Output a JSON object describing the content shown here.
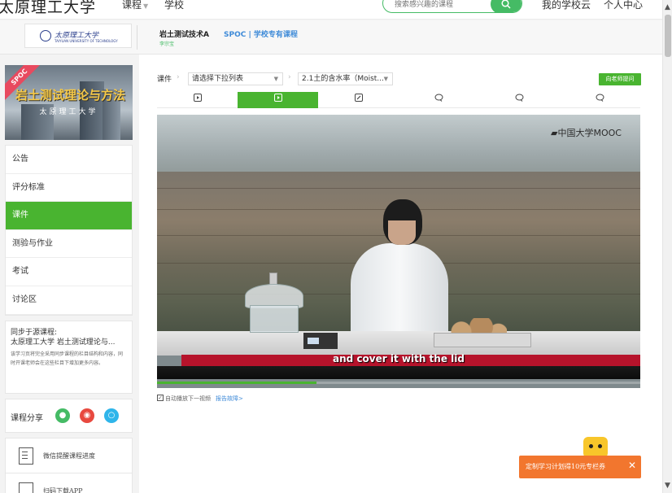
{
  "topnav": {
    "brand": "太原理工大学",
    "course_menu": "课程",
    "school_menu": "学校",
    "search_placeholder": "搜索感兴趣的课程",
    "my_school_cloud": "我的学校云",
    "user_center": "个人中心"
  },
  "course_header": {
    "title": "岩土测试技术A",
    "spoc_label": "SPOC | 学校专有课程",
    "teacher": "李宗宝"
  },
  "sidebar": {
    "cover": {
      "ribbon": "SPOC",
      "title": "岩土测试理论与方法",
      "school": "太原理工大学"
    },
    "menu": [
      {
        "label": "公告"
      },
      {
        "label": "评分标准"
      },
      {
        "label": "课件",
        "active": true
      },
      {
        "label": "测验与作业"
      },
      {
        "label": "考试"
      },
      {
        "label": "讨论区"
      }
    ],
    "sync": {
      "line1": "同步于源课程:",
      "line2": "太原理工大学 岩土测试理论与...",
      "note": "该学习页将完全采用同步课程的栏目结构和内容，同时开课老师会在这些栏目下增加更多内容。"
    },
    "share": {
      "label": "课程分享",
      "icons": [
        "wechat-icon",
        "weibo-icon",
        "qq-icon"
      ],
      "colors": {
        "wechat": "#45bb65",
        "weibo": "#e8493f",
        "qq": "#2fb5ea"
      }
    },
    "wechat_remind": "微信提醒课程进度",
    "app_download": "扫码下载APP"
  },
  "main": {
    "breadcrumb_root": "课件",
    "select_unit": "请选择下拉列表",
    "select_lesson": "2.1土的含水率（Moist...",
    "ask_teacher": "向老师提问",
    "tabs": [
      {
        "icon": "video-icon"
      },
      {
        "icon": "video-icon",
        "active": true
      },
      {
        "icon": "document-icon"
      },
      {
        "icon": "discussion-icon"
      },
      {
        "icon": "discussion-icon"
      },
      {
        "icon": "discussion-icon"
      }
    ],
    "video": {
      "watermark": "中国大学MOOC",
      "subtitle": "and cover it with the lid",
      "progress": 0.33
    },
    "autoplay_label": "自动播放下一视频",
    "report_label": "报告故障>"
  },
  "promo": {
    "text": "定制学习计划得10元专栏券",
    "close": "✕"
  },
  "colors": {
    "accent_green": "#49b430",
    "link_blue": "#3f8bd8",
    "promo_orange": "#f2762e"
  }
}
